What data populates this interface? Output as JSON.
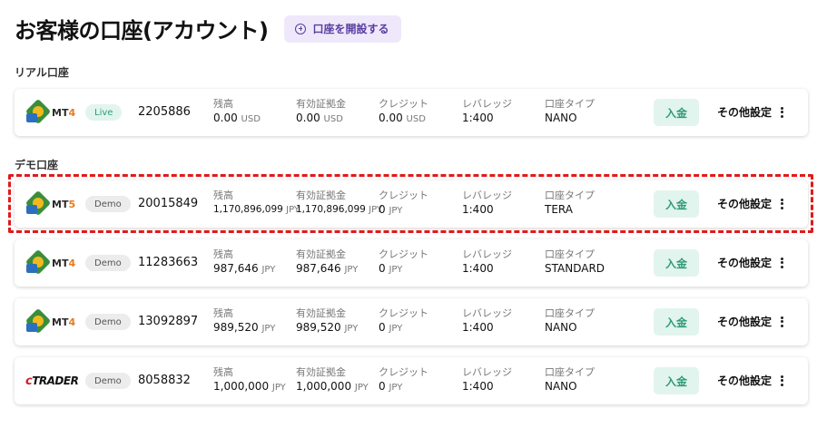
{
  "header": {
    "title": "お客様の口座(アカウント)",
    "open_account_label": "口座を開設する"
  },
  "sections": {
    "real": "リアル口座",
    "demo": "デモ口座"
  },
  "field_labels": {
    "balance": "残高",
    "equity": "有効証拠金",
    "credit": "クレジット",
    "leverage": "レバレッジ",
    "account_type": "口座タイプ"
  },
  "actions": {
    "deposit": "入金",
    "settings": "その他設定"
  },
  "accounts": [
    {
      "platform": "MT",
      "platform_num": "4",
      "status": "Live",
      "number": "2205886",
      "balance": "0.00",
      "balance_unit": "USD",
      "equity": "0.00",
      "equity_unit": "USD",
      "credit": "0.00",
      "credit_unit": "USD",
      "leverage": "1:400",
      "type": "NANO"
    },
    {
      "platform": "MT",
      "platform_num": "5",
      "status": "Demo",
      "number": "20015849",
      "balance": "1,170,896,099",
      "balance_unit": "JPY",
      "equity": "1,170,896,099",
      "equity_unit": "JPY",
      "credit": "0",
      "credit_unit": "JPY",
      "leverage": "1:400",
      "type": "TERA"
    },
    {
      "platform": "MT",
      "platform_num": "4",
      "status": "Demo",
      "number": "11283663",
      "balance": "987,646",
      "balance_unit": "JPY",
      "equity": "987,646",
      "equity_unit": "JPY",
      "credit": "0",
      "credit_unit": "JPY",
      "leverage": "1:400",
      "type": "STANDARD"
    },
    {
      "platform": "MT",
      "platform_num": "4",
      "status": "Demo",
      "number": "13092897",
      "balance": "989,520",
      "balance_unit": "JPY",
      "equity": "989,520",
      "equity_unit": "JPY",
      "credit": "0",
      "credit_unit": "JPY",
      "leverage": "1:400",
      "type": "NANO"
    },
    {
      "platform_c": "c",
      "platform_rest": "TRADER",
      "status": "Demo",
      "number": "8058832",
      "balance": "1,000,000",
      "balance_unit": "JPY",
      "equity": "1,000,000",
      "equity_unit": "JPY",
      "credit": "0",
      "credit_unit": "JPY",
      "leverage": "1:400",
      "type": "NANO"
    }
  ],
  "colors": {
    "accent_purple": "#5a3ea0",
    "live_green": "#2e9b76",
    "highlight_red": "#e01a1a"
  }
}
